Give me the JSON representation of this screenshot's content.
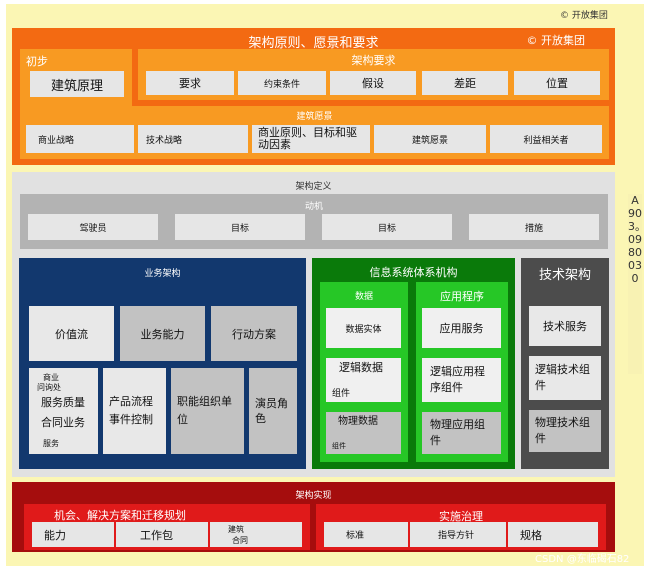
{
  "copyright_top": "© 开放集团",
  "vertical_code": "A903。0980030",
  "watermark": "CSDN @东临碣石82",
  "principles": {
    "title": "架构原则、愿景和要求",
    "copyright": "© 开放集团",
    "preliminary": {
      "title": "初步",
      "item": "建筑原理"
    },
    "requirements": {
      "title": "架构要求",
      "items": [
        "要求",
        "约束条件",
        "假设",
        "差距",
        "位置"
      ]
    },
    "vision": {
      "title": "建筑愿景",
      "items": [
        "商业战略",
        "技术战略",
        "商业原则、目标和驱动因素",
        "建筑愿景",
        "利益相关者"
      ]
    }
  },
  "definition": {
    "title": "架构定义",
    "motivation": {
      "title": "动机",
      "items": [
        "驾驶员",
        "目标",
        "目标",
        "措施"
      ]
    },
    "business": {
      "title": "业务架构",
      "value_stream": "价值流",
      "capability": "业务能力",
      "course_of_action": "行动方案",
      "services_box": {
        "top": "商业",
        "top2": "问询处",
        "quality": "服务质量",
        "contract": "合同业务",
        "service": "服务"
      },
      "product": "产品流程事件控制",
      "org_unit": "职能组织单位",
      "actor_role": "演员角色"
    },
    "information": {
      "title": "信息系统体系机构",
      "data": {
        "title": "数据",
        "entity": "数据实体",
        "logical": "逻辑数据",
        "logical_sub": "组件",
        "physical": "物理数据",
        "physical_sub": "组件"
      },
      "application": {
        "title": "应用程序",
        "service": "应用服务",
        "logical": "逻辑应用程序组件",
        "physical": "物理应用组件"
      }
    },
    "technology": {
      "title": "技术架构",
      "service": "技术服务",
      "logical": "逻辑技术组件",
      "physical": "物理技术组件"
    }
  },
  "realization": {
    "title": "架构实现",
    "opportunities": {
      "title": "机会、解决方案和迁移规划",
      "capability": "能力",
      "work_package": "工作包",
      "contract_top": "建筑",
      "contract_bottom": "合同"
    },
    "governance": {
      "title": "实施治理",
      "items": [
        "标准",
        "指导方针",
        "规格"
      ]
    }
  }
}
